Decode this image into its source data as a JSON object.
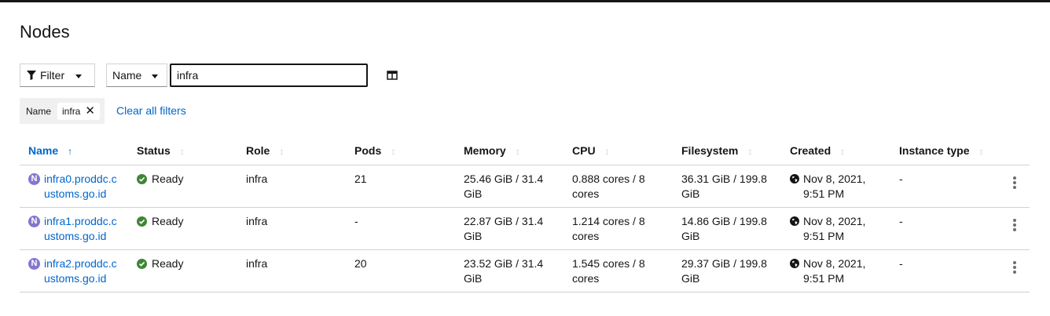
{
  "page": {
    "title": "Nodes"
  },
  "toolbar": {
    "filter_label": "Filter",
    "attribute_select": "Name",
    "search_value": "infra"
  },
  "chips": {
    "category": "Name",
    "value": "infra",
    "close": "✕",
    "clear_all": "Clear all filters"
  },
  "table": {
    "sort_indicator": "↑",
    "unsorted_indicator": "↕",
    "headers": {
      "name": "Name",
      "status": "Status",
      "role": "Role",
      "pods": "Pods",
      "memory": "Memory",
      "cpu": "CPU",
      "filesystem": "Filesystem",
      "created": "Created",
      "instance_type": "Instance type"
    },
    "badge_letter": "N",
    "rows": [
      {
        "name": "infra0.proddc.customs.go.id",
        "status": "Ready",
        "role": "infra",
        "pods": "21",
        "memory": "25.46 GiB / 31.4 GiB",
        "cpu": "0.888 cores / 8 cores",
        "filesystem": "36.31 GiB / 199.8 GiB",
        "created": "Nov 8, 2021, 9:51 PM",
        "instance_type": "-"
      },
      {
        "name": "infra1.proddc.customs.go.id",
        "status": "Ready",
        "role": "infra",
        "pods": "-",
        "memory": "22.87 GiB / 31.4 GiB",
        "cpu": "1.214 cores / 8 cores",
        "filesystem": "14.86 GiB / 199.8 GiB",
        "created": "Nov 8, 2021, 9:51 PM",
        "instance_type": "-"
      },
      {
        "name": "infra2.proddc.customs.go.id",
        "status": "Ready",
        "role": "infra",
        "pods": "20",
        "memory": "23.52 GiB / 31.4 GiB",
        "cpu": "1.545 cores / 8 cores",
        "filesystem": "29.37 GiB / 199.8 GiB",
        "created": "Nov 8, 2021, 9:51 PM",
        "instance_type": "-"
      }
    ]
  },
  "colors": {
    "link": "#0066cc",
    "ready": "#3e8635",
    "node_badge": "#8476d1"
  },
  "icons": {
    "filter": "funnel-icon",
    "columns": "columns-icon",
    "status": "check-circle-icon",
    "created": "globe-icon",
    "actions": "kebab-icon"
  }
}
